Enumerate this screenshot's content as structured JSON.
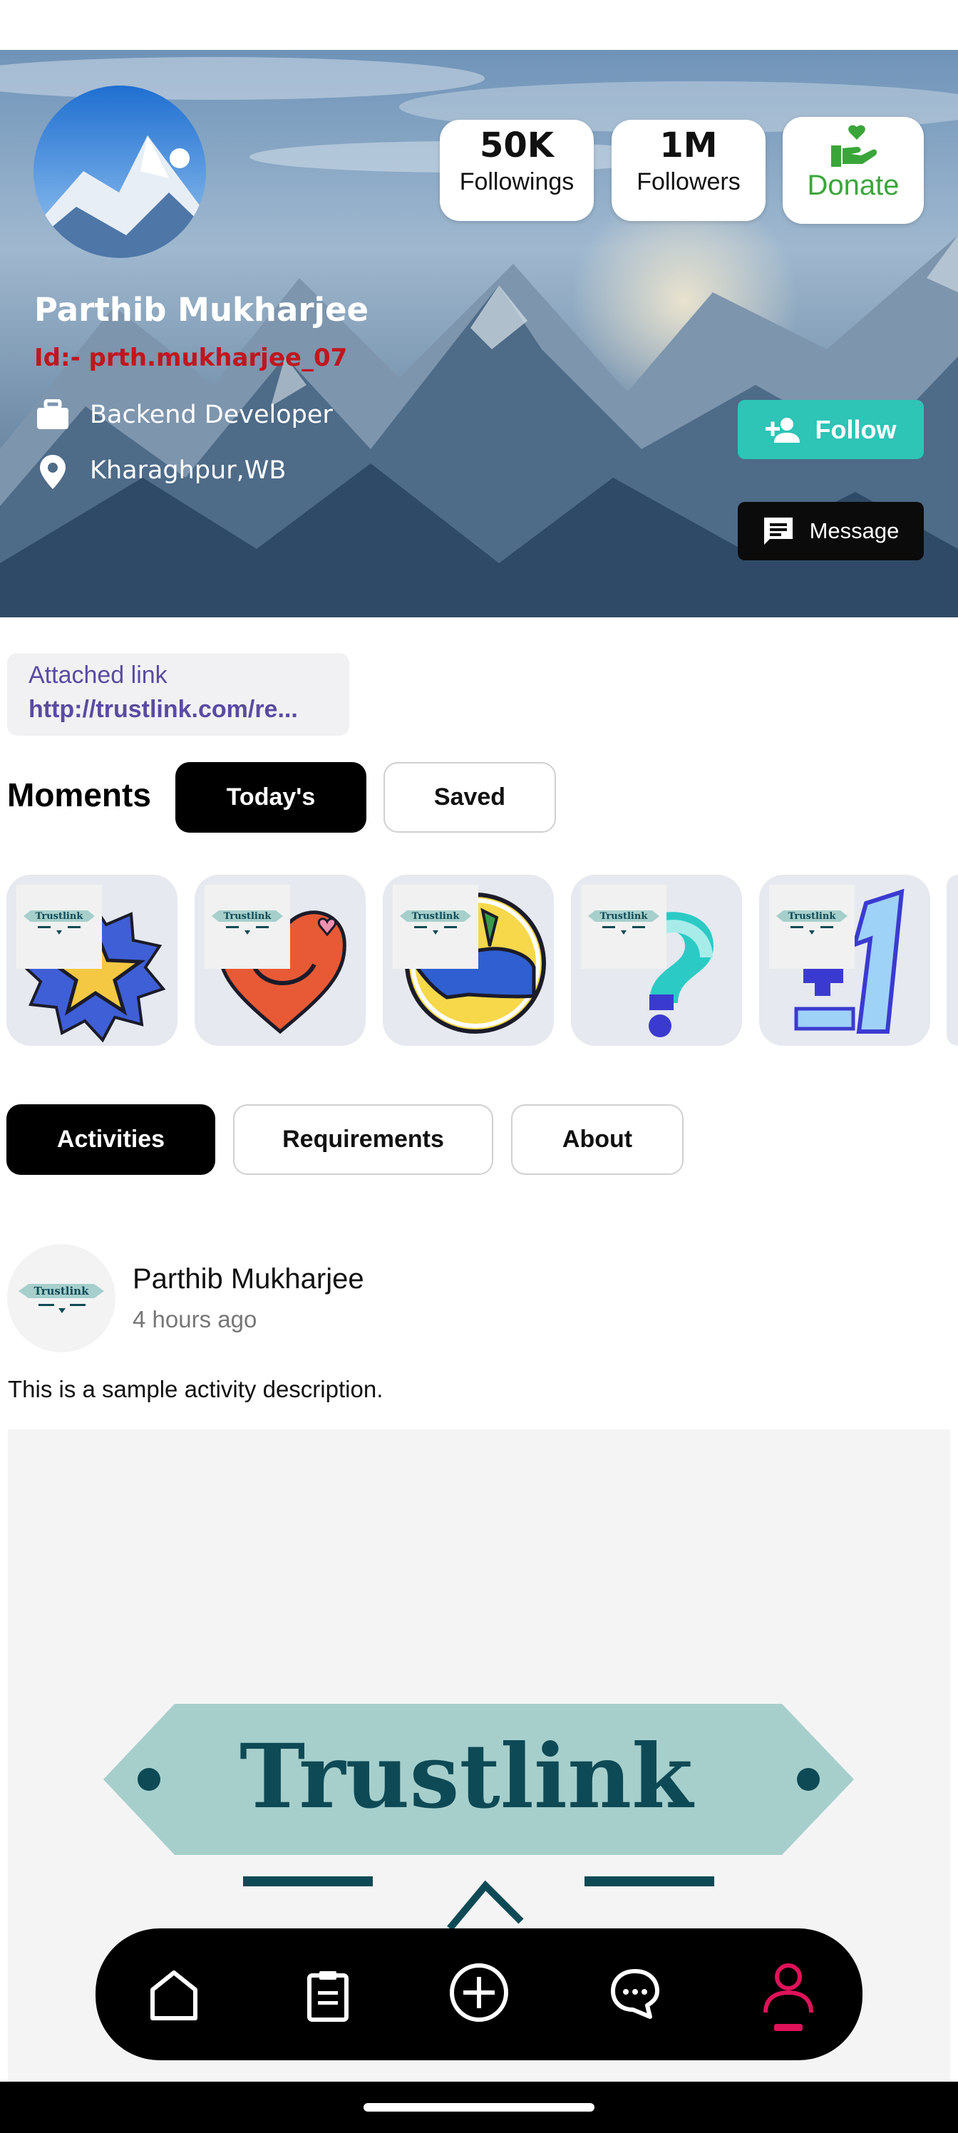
{
  "profile": {
    "name": "Parthib Mukharjee",
    "user_id": "Id:- prth.mukharjee_07",
    "occupation": "Backend Developer",
    "location": "Kharaghpur,WB"
  },
  "stats": {
    "followings_value": "50K",
    "followings_label": "Followings",
    "followers_value": "1M",
    "followers_label": "Followers",
    "donate_label": "Donate"
  },
  "actions": {
    "follow_label": "Follow",
    "message_label": "Message"
  },
  "attached_link": {
    "title": "Attached link",
    "url": "http://trustlink.com/re..."
  },
  "moments": {
    "heading": "Moments",
    "tabs": [
      "Today's",
      "Saved"
    ],
    "active_tab": "Today's",
    "items": [
      {
        "logo_text": "Trustlink",
        "sticker": "star-badge"
      },
      {
        "logo_text": "Trustlink",
        "sticker": "smiling-heart"
      },
      {
        "logo_text": "Trustlink",
        "sticker": "face-profile"
      },
      {
        "logo_text": "Trustlink",
        "sticker": "question-mark"
      },
      {
        "logo_text": "Trustlink",
        "sticker": "plus-one"
      }
    ]
  },
  "section_tabs": {
    "items": [
      "Activities",
      "Requirements",
      "About"
    ],
    "active": "Activities"
  },
  "activity": {
    "author": "Parthib Mukharjee",
    "time": "4 hours ago",
    "description": "This is a sample activity description.",
    "avatar_logo_text": "Trustlink",
    "image_logo_text": "Trustlink"
  },
  "bottom_nav": {
    "items": [
      "home-icon",
      "clipboard-icon",
      "add-icon",
      "chat-icon",
      "profile-icon"
    ],
    "active": "profile-icon"
  },
  "colors": {
    "accent_teal": "#2ec4b6",
    "id_red": "#c0161e",
    "donate_green": "#3aa63a",
    "link_purple": "#5a4ba0",
    "nav_active": "#e0125a",
    "logo_dark": "#0e4a55",
    "logo_band": "#a6cfcc"
  }
}
